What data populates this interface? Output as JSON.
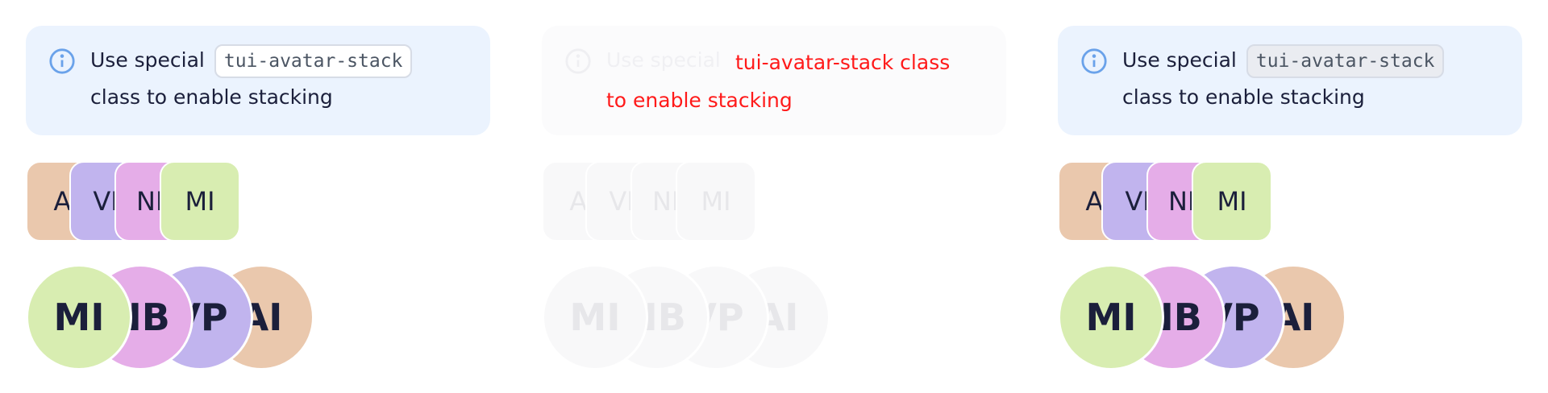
{
  "notice": {
    "prefix": "Use special",
    "code": "tui-avatar-stack",
    "suffix": "class to enable stacking"
  },
  "ghost_notice": {
    "line1": "tui-avatar-stack class",
    "line2": "to enable stacking"
  },
  "square_stack": [
    {
      "initials": "AI",
      "color": "#eac8ad"
    },
    {
      "initials": "VP",
      "color": "#c1b4ee"
    },
    {
      "initials": "NB",
      "color": "#e5ade8"
    },
    {
      "initials": "MI",
      "color": "#d8edb1"
    }
  ],
  "circle_stack": [
    {
      "initials": "MI",
      "color": "#d8edb1"
    },
    {
      "initials": "NB",
      "color": "#e5ade8"
    },
    {
      "initials": "VP",
      "color": "#c1b4ee"
    },
    {
      "initials": "AI",
      "color": "#eac8ad"
    }
  ],
  "colors": {
    "info_accent": "#6aa2ea",
    "notice_bg": "#ebf3fe",
    "ghost_text": "#ff1a1a"
  },
  "icons": {
    "info": "info-circle-icon"
  }
}
